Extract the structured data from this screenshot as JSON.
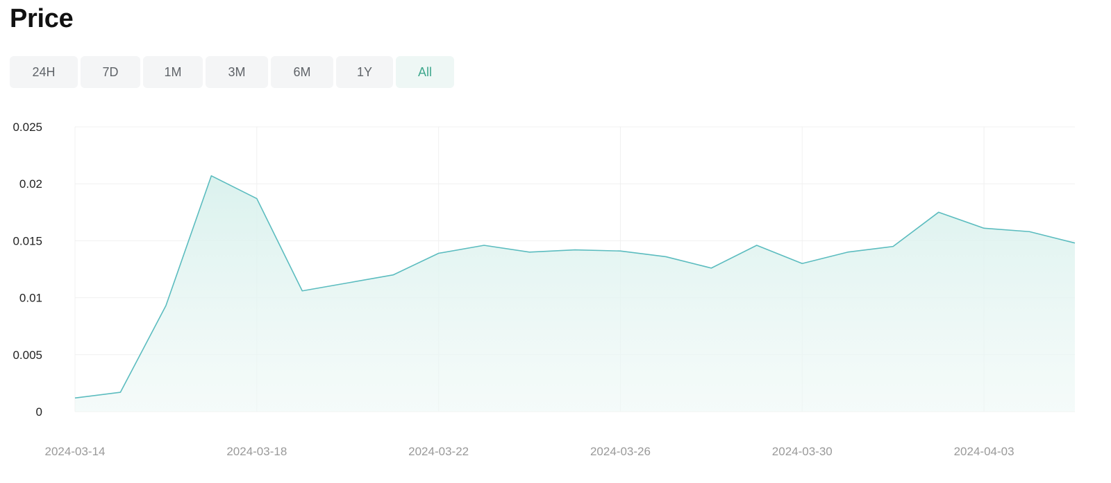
{
  "header": {
    "title": "Price"
  },
  "range_tabs": [
    {
      "label": "24H"
    },
    {
      "label": "7D"
    },
    {
      "label": "1M"
    },
    {
      "label": "3M"
    },
    {
      "label": "6M"
    },
    {
      "label": "1Y"
    },
    {
      "label": "All"
    }
  ],
  "active_tab": "All",
  "colors": {
    "line": "#5bbcbf",
    "fill": "#e6f5f3",
    "active_tab_text": "#3ea78d",
    "grid": "#f0f0f0"
  },
  "chart_data": {
    "type": "area",
    "title": "",
    "xlabel": "",
    "ylabel": "",
    "x": [
      "2024-03-14",
      "2024-03-15",
      "2024-03-16",
      "2024-03-17",
      "2024-03-18",
      "2024-03-19",
      "2024-03-20",
      "2024-03-21",
      "2024-03-22",
      "2024-03-23",
      "2024-03-24",
      "2024-03-25",
      "2024-03-26",
      "2024-03-27",
      "2024-03-28",
      "2024-03-29",
      "2024-03-30",
      "2024-03-31",
      "2024-04-01",
      "2024-04-02",
      "2024-04-03",
      "2024-04-04",
      "2024-04-05"
    ],
    "series": [
      {
        "values": [
          0.0012,
          0.0017,
          0.0093,
          0.0207,
          0.0187,
          0.0106,
          0.0113,
          0.012,
          0.0139,
          0.0146,
          0.014,
          0.0142,
          0.0141,
          0.0136,
          0.0126,
          0.0146,
          0.013,
          0.014,
          0.0145,
          0.0175,
          0.0161,
          0.0158,
          0.0148
        ]
      }
    ],
    "x_tick_labels": [
      "2024-03-14",
      "2024-03-18",
      "2024-03-22",
      "2024-03-26",
      "2024-03-30",
      "2024-04-03"
    ],
    "y_tick_labels": [
      "0",
      "0.005",
      "0.01",
      "0.015",
      "0.02",
      "0.025"
    ],
    "ylim": [
      0,
      0.025
    ],
    "xlim": [
      "2024-03-14",
      "2024-04-05"
    ],
    "grid": true,
    "legend": "none"
  }
}
